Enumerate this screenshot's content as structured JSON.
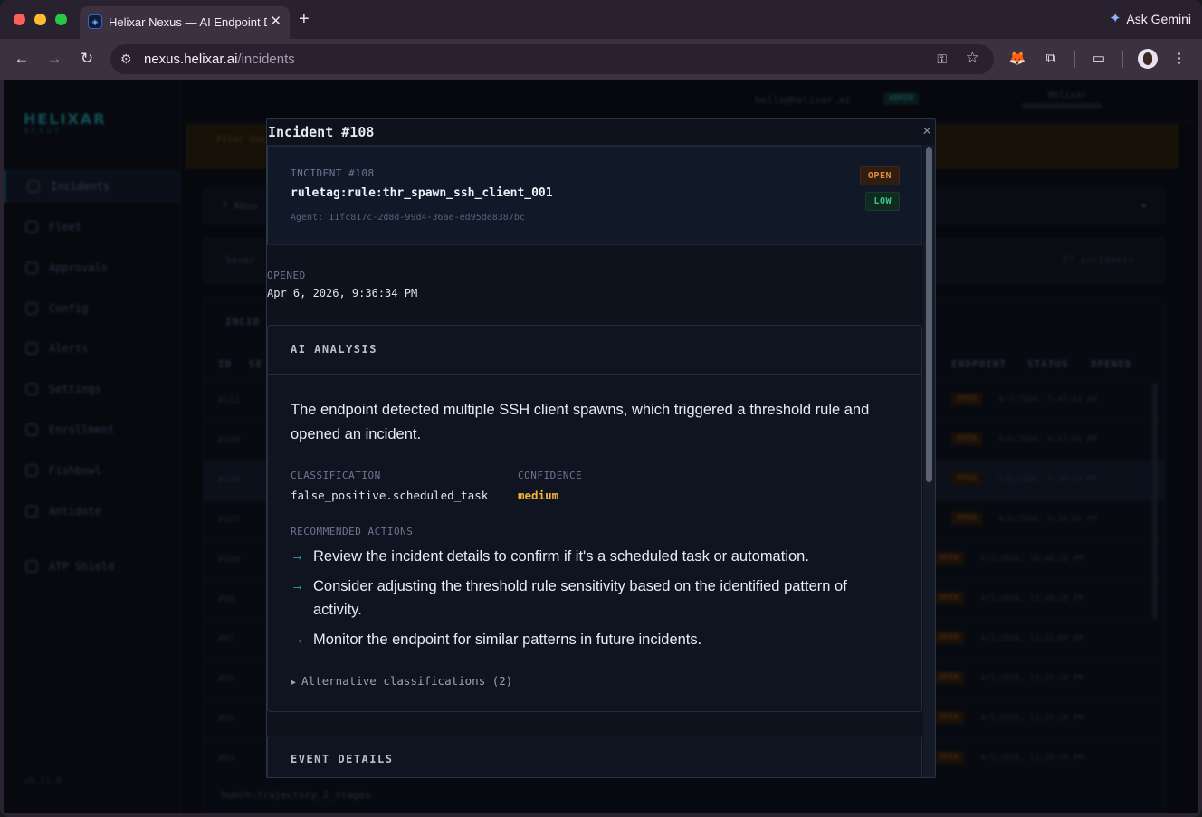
{
  "browser": {
    "tab_title": "Helixar Nexus — AI Endpoint Detection",
    "new_tab": "+",
    "close_tab": "✕",
    "gemini_label": "Ask Gemini",
    "url_host": "nexus.helixar.ai",
    "url_path": "/incidents"
  },
  "sidebar": {
    "logo": "HELIXAR",
    "logo_sub": "NEXUS",
    "items": [
      {
        "label": "Incidents"
      },
      {
        "label": "Fleet"
      },
      {
        "label": "Approvals"
      },
      {
        "label": "Config"
      },
      {
        "label": "Alerts"
      },
      {
        "label": "Settings"
      },
      {
        "label": "Enrollment"
      },
      {
        "label": "Fishbowl"
      },
      {
        "label": "Antidote"
      },
      {
        "label": "ATP Shield"
      }
    ],
    "version": "v0.21.0"
  },
  "topbar": {
    "email": "hello@helixar.ai",
    "role_badge": "ADMIN",
    "user": "Helixar"
  },
  "banner": {
    "text": "Pilot Use ... written permission from Helixar Limited."
  },
  "filters": {
    "filter1": "7 Abou",
    "filter2": "Sever",
    "count": "27 incidents"
  },
  "table": {
    "title": "INCID",
    "headers": [
      "ID",
      "SE",
      "ENDPOINT",
      "STATUS",
      "OPENED"
    ],
    "rows": [
      {
        "id": "#111",
        "status": "OPEN",
        "opened": "4/7/2026, 5:45:34 AM"
      },
      {
        "id": "#109",
        "status": "OPEN",
        "opened": "4/6/2026, 9:37:01 PM"
      },
      {
        "id": "#108",
        "status": "OPEN",
        "opened": "4/6/2026, 9:36:34 PM"
      },
      {
        "id": "#107",
        "status": "OPEN",
        "opened": "4/6/2026, 9:34:02 PM"
      },
      {
        "id": "#100",
        "status": "OPEN",
        "opened": "4/1/2026, 10:40:20 PM"
      },
      {
        "id": "#98",
        "status": "OPEN",
        "opened": "4/1/2026, 12:49:28 PM"
      },
      {
        "id": "#97",
        "status": "OPEN",
        "opened": "4/1/2026, 12:22:00 AM"
      },
      {
        "id": "#96",
        "status": "OPEN",
        "opened": "4/1/2026, 12:15:30 PM"
      },
      {
        "id": "#95",
        "status": "OPEN",
        "opened": "4/1/2026, 12:15:29 PM"
      },
      {
        "id": "#93",
        "status": "OPEN",
        "opened": "4/1/2026, 12:16:55 PM"
      }
    ],
    "last_row": "hunch:trajectory_2_stages"
  },
  "modal": {
    "title": "Incident #108",
    "close": "×",
    "incident_tag": "INCIDENT #108",
    "rule": "ruletag:rule:thr_spawn_ssh_client_001",
    "agent": "Agent: 11fc817c-2d8d-99d4-36ae-ed95de8387bc",
    "status_badge": "OPEN",
    "severity_badge": "LOW",
    "opened_label": "OPENED",
    "opened_value": "Apr 6, 2026, 9:36:34 PM",
    "ai_title": "AI ANALYSIS",
    "ai_summary": "The endpoint detected multiple SSH client spawns, which triggered a threshold rule and opened an incident.",
    "classification_label": "CLASSIFICATION",
    "classification_value": "false_positive.scheduled_task",
    "confidence_label": "CONFIDENCE",
    "confidence_value": "medium",
    "confidence_color": "#f2b534",
    "recommended_label": "RECOMMENDED ACTIONS",
    "actions": [
      "Review the incident details to confirm if it's a scheduled task or automation.",
      "Consider adjusting the threshold rule sensitivity based on the identified pattern of activity.",
      "Monitor the endpoint for similar patterns in future incidents."
    ],
    "alternatives": "Alternative classifications (2)",
    "event_title": "EVENT DETAILS"
  },
  "colors": {
    "accent": "#2fb3c6",
    "open": "#e08a3a",
    "low": "#3ec48a"
  }
}
